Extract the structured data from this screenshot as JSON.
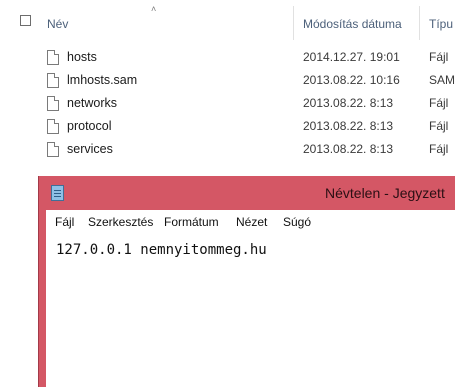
{
  "explorer": {
    "columns": {
      "name": "Név",
      "modified": "Módosítás dátuma",
      "type": "Típu"
    },
    "files": [
      {
        "name": "hosts",
        "date": "2014.12.27. 19:01",
        "type": "Fájl"
      },
      {
        "name": "lmhosts.sam",
        "date": "2013.08.22. 10:16",
        "type": "SAM"
      },
      {
        "name": "networks",
        "date": "2013.08.22. 8:13",
        "type": "Fájl"
      },
      {
        "name": "protocol",
        "date": "2013.08.22. 8:13",
        "type": "Fájl"
      },
      {
        "name": "services",
        "date": "2013.08.22. 8:13",
        "type": "Fájl"
      }
    ]
  },
  "notepad": {
    "title": "Névtelen - Jegyzett",
    "icon": "notepad-icon",
    "accent_color": "#d45765",
    "menu": [
      "Fájl",
      "Szerkesztés",
      "Formátum",
      "Nézet",
      "Súgó"
    ],
    "content": "127.0.0.1 nemnyitommeg.hu"
  }
}
